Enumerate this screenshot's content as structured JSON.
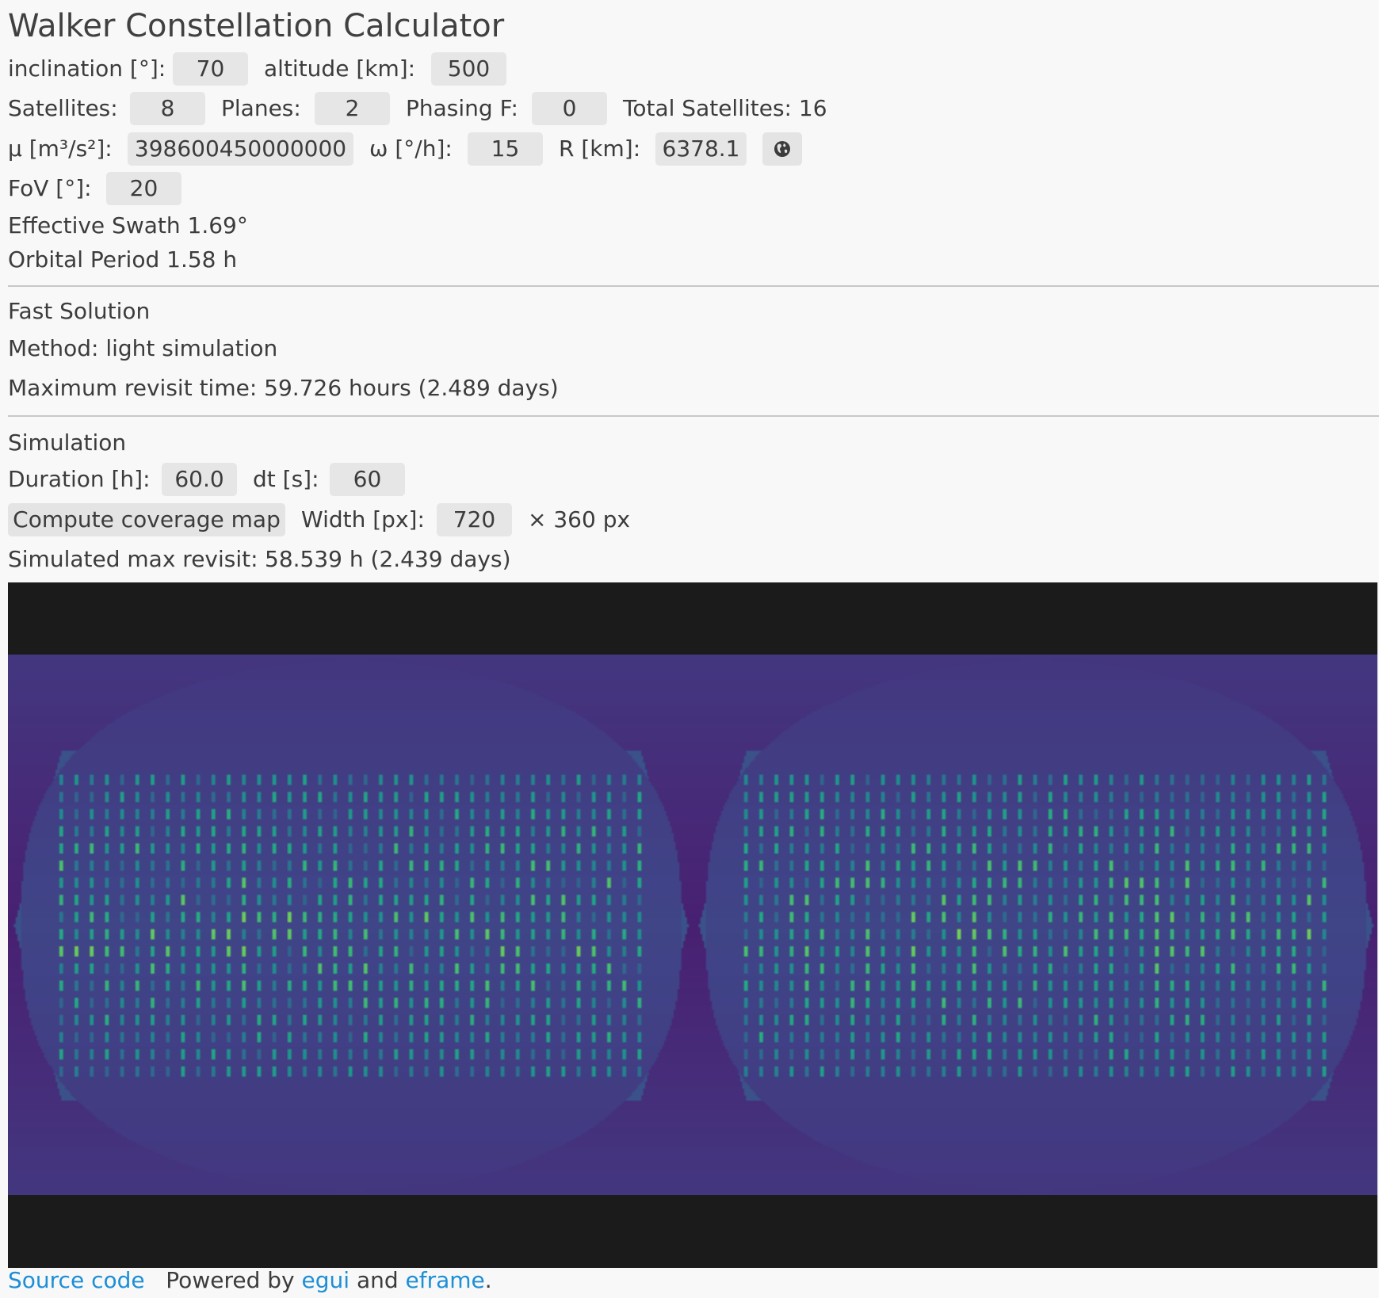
{
  "title": "Walker Constellation Calculator",
  "orbit": {
    "inclination_label": "inclination [°]:",
    "inclination": "70",
    "altitude_label": "altitude [km]:",
    "altitude": "500"
  },
  "constellation": {
    "satellites_label": "Satellites:",
    "satellites": "8",
    "planes_label": "Planes:",
    "planes": "2",
    "phasing_label": "Phasing F:",
    "phasing": "0",
    "total_text": "Total Satellites: 16"
  },
  "body": {
    "mu_label": "μ [m³/s²]:",
    "mu": "398600450000000",
    "omega_label": "ω [°/h]:",
    "omega": "15",
    "radius_label": "R [km]:",
    "radius": "6378.1",
    "earth_icon": "globe-icon"
  },
  "sensor": {
    "fov_label": "FoV [°]:",
    "fov": "20"
  },
  "derived": {
    "swath": "Effective Swath 1.69°",
    "period": "Orbital Period 1.58 h"
  },
  "fast": {
    "heading": "Fast Solution",
    "method": "Method: light simulation",
    "max_revisit": "Maximum revisit time: 59.726 hours (2.489 days)"
  },
  "simulation": {
    "heading": "Simulation",
    "duration_label": "Duration [h]:",
    "duration": "60.0",
    "dt_label": "dt [s]:",
    "dt": "60",
    "compute_button": "Compute coverage map",
    "width_label": "Width [px]:",
    "width": "720",
    "height_text": "× 360 px",
    "sim_label": "Simulated max revisit:",
    "sim_value": "58.539 h (2.439 days)"
  },
  "footer": {
    "source": "Source code",
    "powered": "Powered by",
    "egui": "egui",
    "and": "and",
    "eframe": "eframe",
    "period": "."
  },
  "colors": {
    "background": "#f8f8f8",
    "field": "#e6e6e6",
    "link": "#1d8fd6",
    "map_frame": "#1b1b1b",
    "map_low": "#440154",
    "map_mid": "#3b528b",
    "map_high": "#5ec962"
  }
}
